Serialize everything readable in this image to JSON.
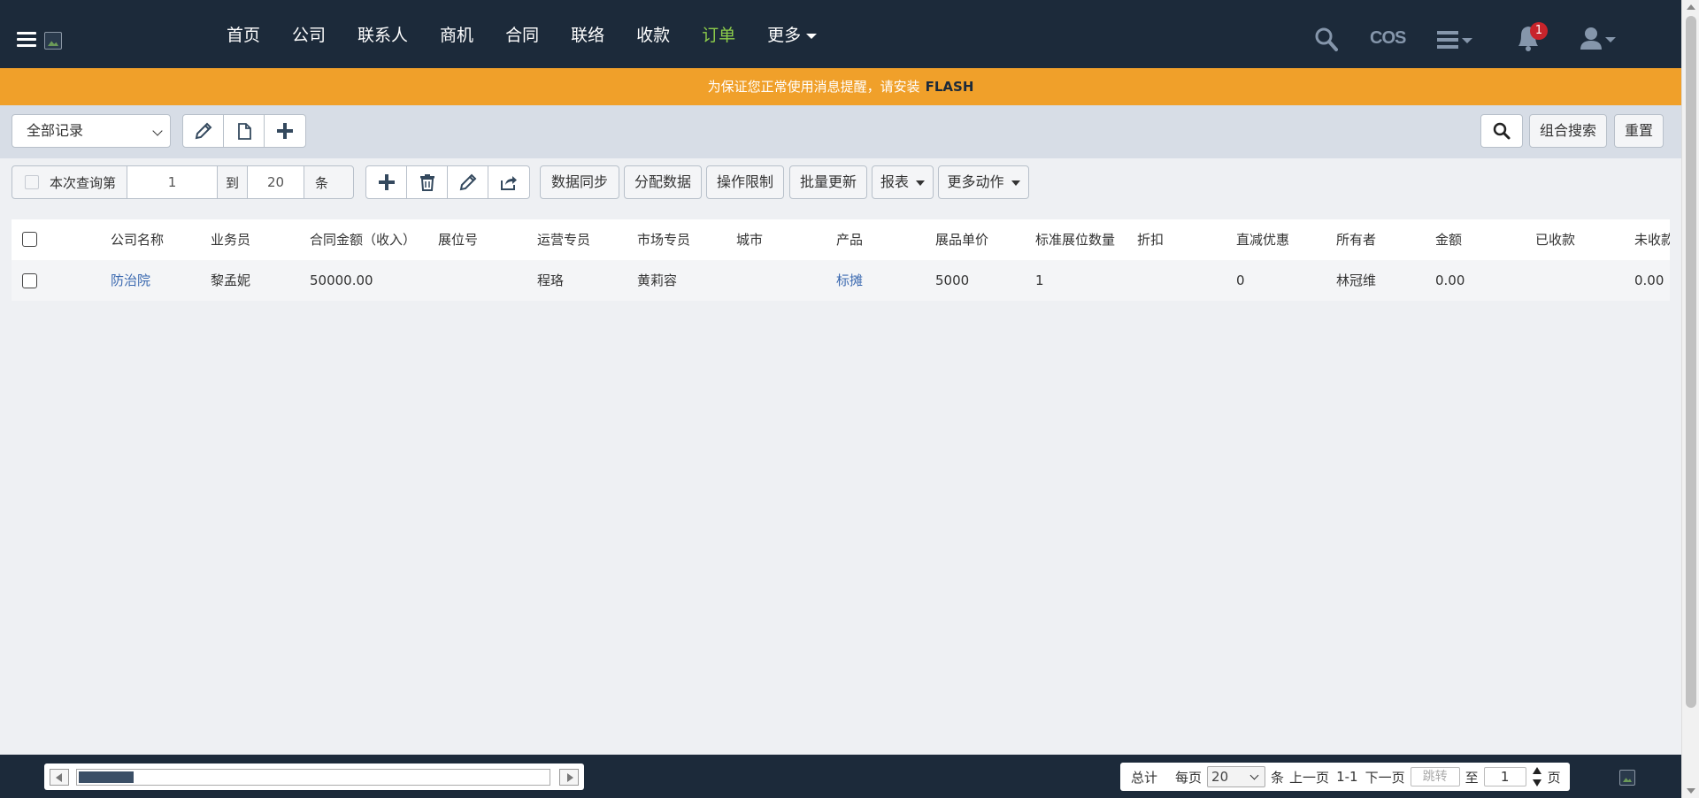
{
  "nav": {
    "menu": [
      {
        "label": "首页",
        "active": false
      },
      {
        "label": "公司",
        "active": false
      },
      {
        "label": "联系人",
        "active": false
      },
      {
        "label": "商机",
        "active": false
      },
      {
        "label": "合同",
        "active": false
      },
      {
        "label": "联络",
        "active": false
      },
      {
        "label": "收款",
        "active": false
      },
      {
        "label": "订单",
        "active": true
      },
      {
        "label": "更多",
        "active": false
      }
    ],
    "cos_label": "COS",
    "notification_count": "1",
    "active_color": "#8ccc4a"
  },
  "flash": {
    "message": "为保证您正常使用消息提醒，请安装",
    "highlight": "FLASH"
  },
  "filter": {
    "record_scope": "全部记录",
    "search_combo_label": "组合搜索",
    "reset_label": "重置"
  },
  "actions": {
    "range_prefix": "本次查询第",
    "range_from": "1",
    "range_to_label": "到",
    "range_to": "20",
    "range_suffix": "条",
    "buttons": [
      "数据同步",
      "分配数据",
      "操作限制",
      "批量更新",
      "报表",
      "更多动作"
    ]
  },
  "table": {
    "columns": [
      "公司名称",
      "业务员",
      "合同金额（收入）",
      "展位号",
      "运营专员",
      "市场专员",
      "城市",
      "产品",
      "展品单价",
      "标准展位数量",
      "折扣",
      "直减优惠",
      "所有者",
      "金额",
      "已收款",
      "未收款"
    ],
    "rows": [
      [
        "防治院",
        "黎孟妮",
        "50000.00",
        "",
        "程珞",
        "黄莉容",
        "",
        "标摊",
        "5000",
        "1",
        "",
        "0",
        "林冠维",
        "0.00",
        "",
        "0.00"
      ]
    ]
  },
  "pager": {
    "total_label": "总计",
    "per_page_label": "每页",
    "per_page": "20",
    "unit": "条",
    "prev": "上一页",
    "range": "1-1",
    "next": "下一页",
    "jump_placeholder": "跳转",
    "to_label": "至",
    "page": "1",
    "page_label": "页"
  },
  "colors": {
    "nav_bg": "#1c2a3a",
    "flash_bg": "#f0a02a",
    "link": "#3c6ab0"
  }
}
